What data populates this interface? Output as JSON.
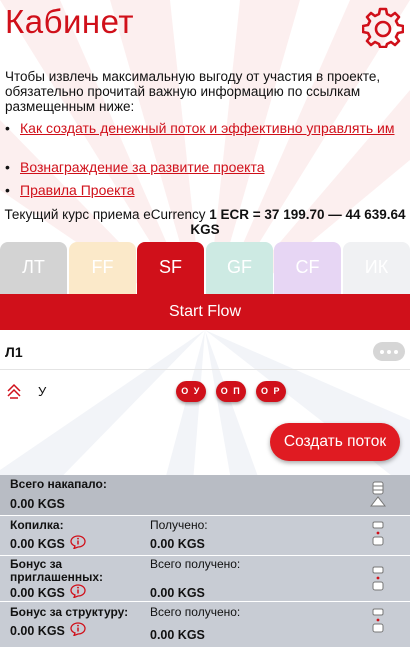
{
  "header": {
    "title": "Кабинет"
  },
  "intro": "Чтобы извлечь максимальную выгоду от участия в проекте, обязательно прочитай важную информацию по ссылкам размещенным ниже:",
  "links": [
    {
      "bullet": "•",
      "label": "Как создать денежный поток и эффективно управлять им"
    },
    {
      "bullet": "•",
      "label": "Вознаграждение за развитие проекта"
    },
    {
      "bullet": "•",
      "label": "Правила Проекта"
    }
  ],
  "rate": {
    "prefix": "Текущий курс приема eCurrency ",
    "value": "1 ECR = 37 199.70 — 44 639.64 KGS"
  },
  "tabs": [
    {
      "label": "ЛТ",
      "color": "#d3d3d3"
    },
    {
      "label": "FF",
      "color": "#fbe9c9"
    },
    {
      "label": "SF",
      "color": "#d0101a"
    },
    {
      "label": "GF",
      "color": "#cdeae3"
    },
    {
      "label": "CF",
      "color": "#e7d6f4"
    },
    {
      "label": "ИК",
      "color": "#f0f1f3"
    }
  ],
  "flow_bar": {
    "label": "Start Flow"
  },
  "level": {
    "label": "Л1"
  },
  "u_row": {
    "label": "У",
    "pills": [
      "О У",
      "О П",
      "О Р"
    ]
  },
  "create_button": {
    "label": "Создать поток"
  },
  "stats": {
    "total": {
      "label": "Всего накапало:",
      "value": "0.00 KGS"
    },
    "piggy": {
      "label": "Копилка:",
      "value": "0.00 KGS",
      "right_label": "Получено:",
      "right_value": "0.00 KGS"
    },
    "invited": {
      "label": "Бонус за приглашенных:",
      "value": "0.00 KGS",
      "right_label": "Всего получено:",
      "right_value": "0.00 KGS"
    },
    "structure": {
      "label": "Бонус за структуру:",
      "value": "0.00 KGS",
      "right_label": "Всего получено:",
      "right_value": "0.00 KGS"
    }
  },
  "colors": {
    "accent": "#d0101a",
    "stat_bg": "#c8ccd4"
  }
}
